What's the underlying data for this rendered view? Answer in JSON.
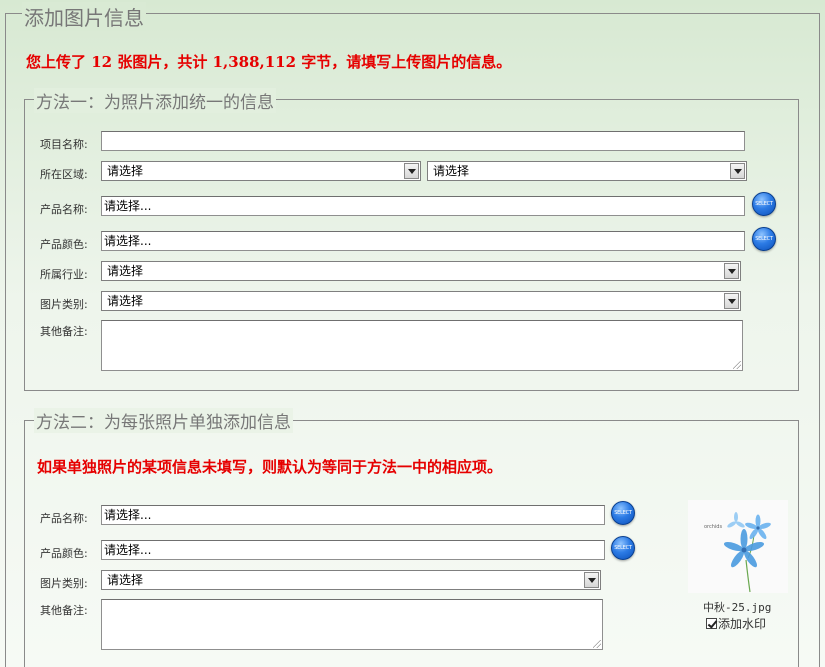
{
  "page_title": "添加图片信息",
  "upload_summary": "您上传了 12 张图片，共计 1,388,112 字节，请填写上传图片的信息。",
  "method1": {
    "legend": "方法一：为照片添加统一的信息",
    "project_name_label": "项目名称:",
    "project_name_value": "",
    "region_label": "所在区域:",
    "region_select_1": "请选择",
    "region_select_2": "请选择",
    "product_name_label": "产品名称:",
    "product_name_value": "请选择...",
    "product_color_label": "产品颜色:",
    "product_color_value": "请选择...",
    "industry_label": "所属行业:",
    "industry_value": "请选择",
    "category_label": "图片类别:",
    "category_value": "请选择",
    "notes_label": "其他备注:",
    "select_button": "SELECT"
  },
  "method2": {
    "legend": "方法二：为每张照片单独添加信息",
    "note": "如果单独照片的某项信息未填写，则默认为等同于方法一中的相应项。",
    "product_name_label": "产品名称:",
    "product_name_value": "请选择...",
    "product_color_label": "产品颜色:",
    "product_color_value": "请选择...",
    "category_label": "图片类别:",
    "category_value": "请选择",
    "notes_label": "其他备注:",
    "select_button": "SELECT",
    "thumbnail_caption": "orchids",
    "file_name": "中秋-25.jpg",
    "watermark_label": "添加水印",
    "watermark_checked": true
  },
  "colors": {
    "accent_red": "#e60000",
    "select_button_blue": "#2c7be5",
    "flower_blue": "#4a9be0"
  }
}
